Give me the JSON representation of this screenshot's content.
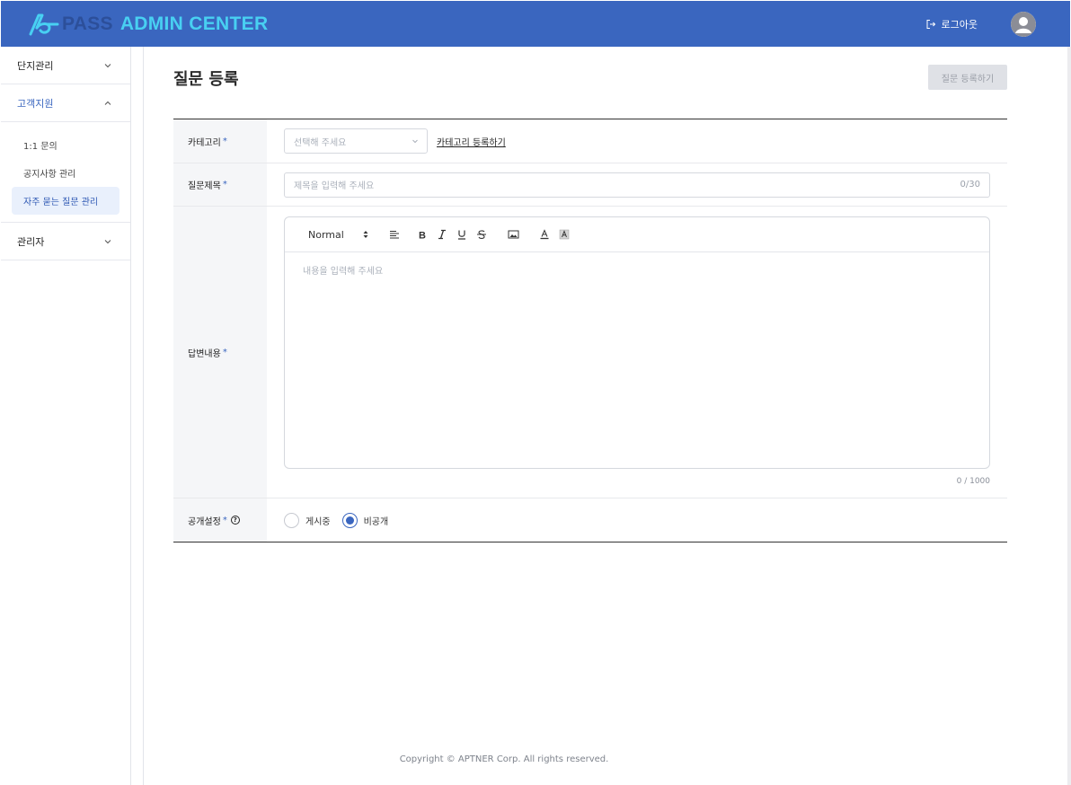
{
  "header": {
    "logo_pass": "PASS",
    "logo_admin": "ADMIN CENTER",
    "logout_label": "로그아웃",
    "bg_color": "#3a66bf"
  },
  "sidebar": {
    "groups": [
      {
        "label": "단지관리",
        "expanded": false
      },
      {
        "label": "고객지원",
        "expanded": true
      },
      {
        "label": "관리자",
        "expanded": false
      }
    ],
    "sub_items": [
      {
        "label": "1:1 문의"
      },
      {
        "label": "공지사항 관리"
      },
      {
        "label": "자주 묻는 질문 관리",
        "selected": true
      }
    ]
  },
  "main": {
    "title": "질문 등록",
    "submit_label": "질문 등록하기",
    "form": {
      "category": {
        "label": "카테고리",
        "placeholder": "선택해 주세요",
        "link_label": "카테고리 등록하기"
      },
      "subject": {
        "label": "질문제목",
        "placeholder": "제목을 입력해 주세요",
        "counter": "0/30"
      },
      "answer": {
        "label": "답변내용",
        "toolbar_format": "Normal",
        "placeholder": "내용을 입력해 주세요",
        "counter": "0 / 1000"
      },
      "visibility": {
        "label": "공개설정",
        "options": [
          {
            "label": "게시중",
            "checked": false
          },
          {
            "label": "비공개",
            "checked": true
          }
        ]
      },
      "required_mark": "*",
      "help_mark": "?"
    }
  },
  "footer": {
    "copyright": "Copyright © APTNER Corp. All rights reserved."
  }
}
